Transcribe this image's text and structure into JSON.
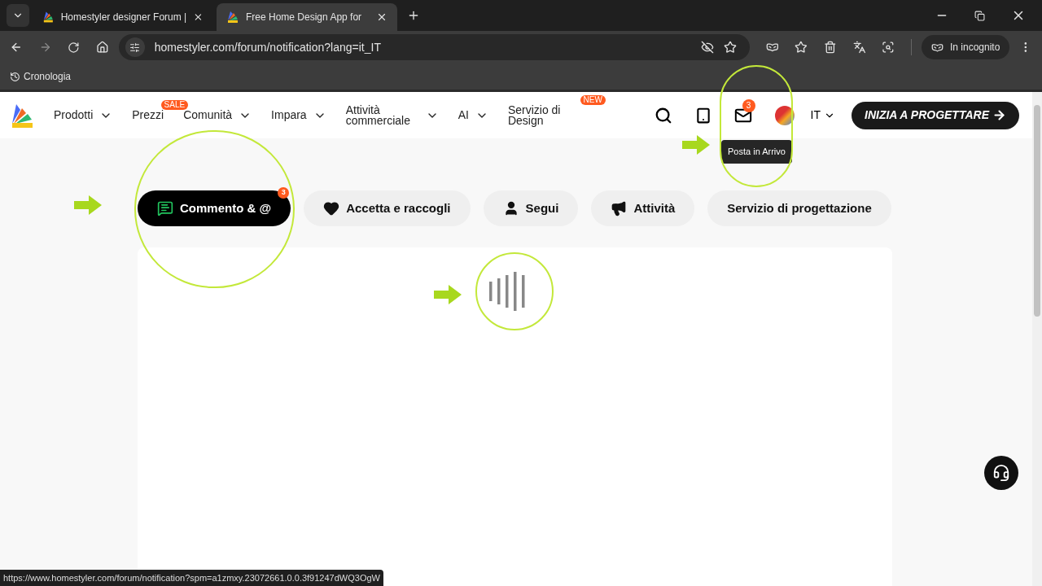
{
  "browser": {
    "tabs": [
      {
        "title": "Homestyler designer Forum |",
        "selected": false
      },
      {
        "title": "Free Home Design App for",
        "selected": true
      }
    ],
    "address": "homestyler.com/forum/notification?lang=it_IT",
    "profile": "In incognito",
    "bookmarks": [
      "Cronologia"
    ],
    "status_url": "https://www.homestyler.com/forum/notification?spm=a1zmxy.23072661.0.0.3f91247dWQ3OgW"
  },
  "nav": {
    "items": [
      {
        "label": "Prodotti",
        "caret": true
      },
      {
        "label": "Prezzi",
        "caret": false,
        "badge": "SALE"
      },
      {
        "label": "Comunità",
        "caret": true
      },
      {
        "label": "Impara",
        "caret": true
      },
      {
        "label": "Attività commerciale",
        "caret": true
      },
      {
        "label": "AI",
        "caret": true
      },
      {
        "label": "Servizio di Design",
        "caret": false,
        "badge": "NEW"
      }
    ],
    "inbox_badge": "3",
    "language": "IT",
    "cta": "INIZIA A PROGETTARE",
    "tooltip": "Posta in Arrivo"
  },
  "filters": [
    {
      "label": "Commento & @",
      "kind": "comment",
      "selected": true,
      "badge": "3"
    },
    {
      "label": "Accetta e raccogli",
      "kind": "heart",
      "selected": false
    },
    {
      "label": "Segui",
      "kind": "user",
      "selected": false
    },
    {
      "label": "Attività",
      "kind": "megaphone",
      "selected": false
    },
    {
      "label": "Servizio di progettazione",
      "kind": "plain",
      "selected": false
    }
  ]
}
